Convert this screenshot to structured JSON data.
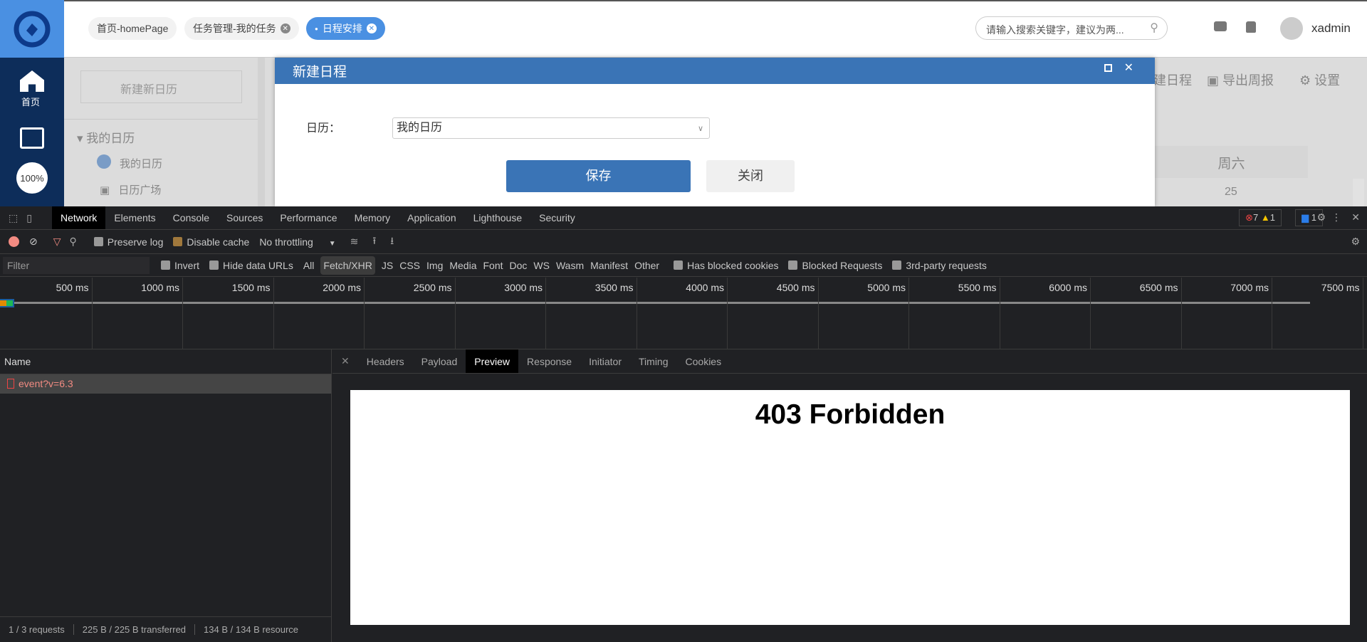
{
  "header": {
    "tabs": [
      {
        "label": "首页-homePage",
        "closable": false,
        "active": false
      },
      {
        "label": "任务管理-我的任务",
        "closable": true,
        "active": false
      },
      {
        "label": "日程安排",
        "closable": true,
        "active": true
      }
    ],
    "search_placeholder": "请输入搜索关键字，建议为两...",
    "username": "xadmin"
  },
  "leftnav": {
    "home": "首页",
    "zoom": "100%"
  },
  "sidebar": {
    "new_calendar": "新建新日历",
    "group": "我的日历",
    "items": [
      "我的日历",
      "日历广场"
    ]
  },
  "toolbar": {
    "new_event": "建日程",
    "export": "导出周报",
    "settings": "设置"
  },
  "calendar": {
    "weekday": "周六",
    "date": "25"
  },
  "modal": {
    "title": "新建日程",
    "field_label": "日历：",
    "field_value": "我的日历",
    "save": "保存",
    "close": "关闭"
  },
  "devtools": {
    "tabs": [
      "Network",
      "Elements",
      "Console",
      "Sources",
      "Performance",
      "Memory",
      "Application",
      "Lighthouse",
      "Security"
    ],
    "errors": "7",
    "warnings": "1",
    "messages": "1",
    "preserve_log": "Preserve log",
    "disable_cache": "Disable cache",
    "throttling": "No throttling",
    "filter_placeholder": "Filter",
    "invert": "Invert",
    "hide_data_urls": "Hide data URLs",
    "types": [
      "All",
      "Fetch/XHR",
      "JS",
      "CSS",
      "Img",
      "Media",
      "Font",
      "Doc",
      "WS",
      "Wasm",
      "Manifest",
      "Other"
    ],
    "extra_filters": [
      "Has blocked cookies",
      "Blocked Requests",
      "3rd-party requests"
    ],
    "timeline_ticks": [
      "500 ms",
      "1000 ms",
      "1500 ms",
      "2000 ms",
      "2500 ms",
      "3000 ms",
      "3500 ms",
      "4000 ms",
      "4500 ms",
      "5000 ms",
      "5500 ms",
      "6000 ms",
      "6500 ms",
      "7000 ms",
      "7500 ms"
    ],
    "name_header": "Name",
    "request": "event?v=6.3",
    "detail_tabs": [
      "Headers",
      "Payload",
      "Preview",
      "Response",
      "Initiator",
      "Timing",
      "Cookies"
    ],
    "preview_text": "403 Forbidden",
    "status": [
      "1 / 3 requests",
      "225 B / 225 B transferred",
      "134 B / 134 B resource"
    ]
  }
}
